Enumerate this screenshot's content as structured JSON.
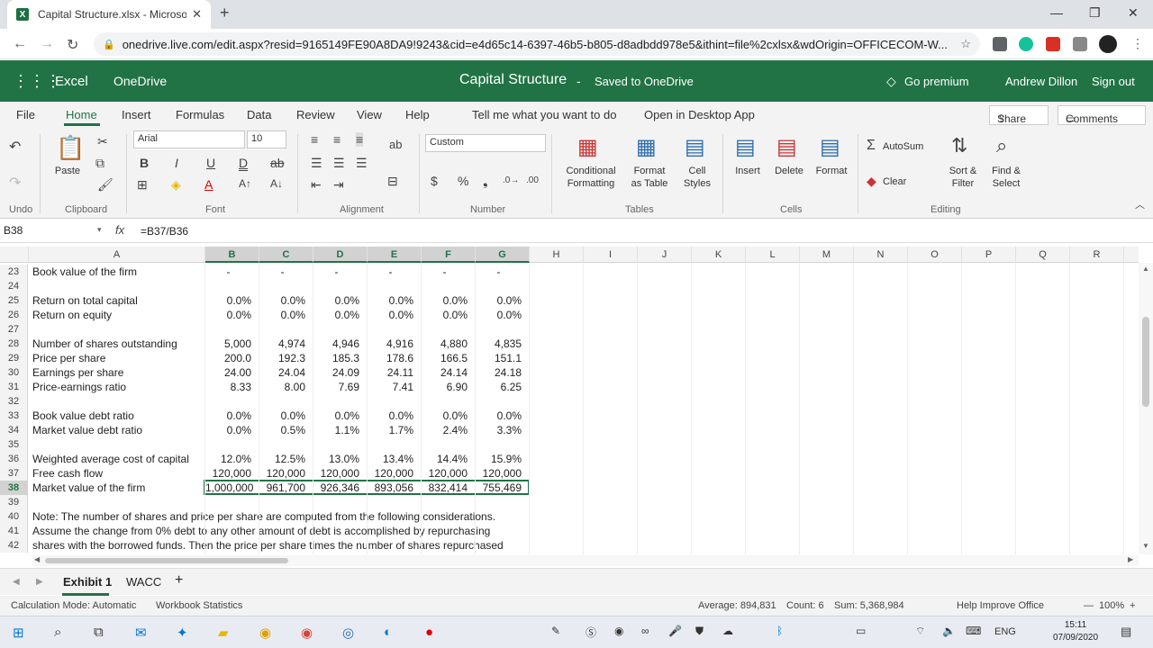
{
  "browser": {
    "tab_title": "Capital Structure.xlsx - Microsoft",
    "url": "onedrive.live.com/edit.aspx?resid=9165149FE90A8DA9!9243&cid=e4d65c14-6397-46b5-b805-d8adbdd978e5&ithint=file%2cxlsx&wdOrigin=OFFICECOM-W..."
  },
  "app": {
    "name": "Excel",
    "service": "OneDrive",
    "doc_title": "Capital Structure",
    "separator": "-",
    "save_status": "Saved to OneDrive",
    "premium": "Go premium",
    "user": "Andrew Dillon",
    "signout": "Sign out"
  },
  "ribbon_tabs": [
    "File",
    "Home",
    "Insert",
    "Formulas",
    "Data",
    "Review",
    "View",
    "Help",
    "Tell me what you want to do",
    "Open in Desktop App"
  ],
  "share_label": "Share",
  "comments_label": "Comments",
  "ribbon": {
    "undo": "Undo",
    "paste": "Paste",
    "clipboard": "Clipboard",
    "font_name": "Arial",
    "font_size": "10",
    "font": "Font",
    "alignment": "Alignment",
    "number_format": "Custom",
    "number": "Number",
    "cond_fmt_1": "Conditional",
    "cond_fmt_2": "Formatting",
    "fmt_table_1": "Format",
    "fmt_table_2": "as Table",
    "cell_styles_1": "Cell",
    "cell_styles_2": "Styles",
    "tables": "Tables",
    "insert": "Insert",
    "delete": "Delete",
    "format": "Format",
    "cells": "Cells",
    "autosum": "AutoSum",
    "clear": "Clear",
    "sort_1": "Sort &",
    "sort_2": "Filter",
    "find_1": "Find &",
    "find_2": "Select",
    "editing": "Editing"
  },
  "formula_bar": {
    "name_box": "B38",
    "fx": "fx",
    "formula": "=B37/B36"
  },
  "columns": [
    "A",
    "B",
    "C",
    "D",
    "E",
    "F",
    "G",
    "H",
    "I",
    "J",
    "K",
    "L",
    "M",
    "N",
    "O",
    "P",
    "Q",
    "R"
  ],
  "rows": [
    {
      "n": "23",
      "label": "Book value of the firm",
      "vals": [
        "-",
        "-",
        "-",
        "-",
        "-",
        "-"
      ]
    },
    {
      "n": "24",
      "label": "",
      "vals": []
    },
    {
      "n": "25",
      "label": "Return on total capital",
      "vals": [
        "0.0%",
        "0.0%",
        "0.0%",
        "0.0%",
        "0.0%",
        "0.0%"
      ]
    },
    {
      "n": "26",
      "label": "Return on equity",
      "vals": [
        "0.0%",
        "0.0%",
        "0.0%",
        "0.0%",
        "0.0%",
        "0.0%"
      ]
    },
    {
      "n": "27",
      "label": "",
      "vals": []
    },
    {
      "n": "28",
      "label": "Number of shares outstanding",
      "vals": [
        "5,000",
        "4,974",
        "4,946",
        "4,916",
        "4,880",
        "4,835"
      ]
    },
    {
      "n": "29",
      "label": "Price per share",
      "vals": [
        "200.0",
        "192.3",
        "185.3",
        "178.6",
        "166.5",
        "151.1"
      ]
    },
    {
      "n": "30",
      "label": "Earnings per share",
      "vals": [
        "24.00",
        "24.04",
        "24.09",
        "24.11",
        "24.14",
        "24.18"
      ]
    },
    {
      "n": "31",
      "label": "Price-earnings ratio",
      "vals": [
        "8.33",
        "8.00",
        "7.69",
        "7.41",
        "6.90",
        "6.25"
      ]
    },
    {
      "n": "32",
      "label": "",
      "vals": []
    },
    {
      "n": "33",
      "label": "Book value debt ratio",
      "vals": [
        "0.0%",
        "0.0%",
        "0.0%",
        "0.0%",
        "0.0%",
        "0.0%"
      ]
    },
    {
      "n": "34",
      "label": "Market value debt ratio",
      "vals": [
        "0.0%",
        "0.5%",
        "1.1%",
        "1.7%",
        "2.4%",
        "3.3%"
      ]
    },
    {
      "n": "35",
      "label": "",
      "vals": []
    },
    {
      "n": "36",
      "label": "Weighted average cost of capital",
      "vals": [
        "12.0%",
        "12.5%",
        "13.0%",
        "13.4%",
        "14.4%",
        "15.9%"
      ]
    },
    {
      "n": "37",
      "label": "Free cash flow",
      "vals": [
        "120,000",
        "120,000",
        "120,000",
        "120,000",
        "120,000",
        "120,000"
      ]
    },
    {
      "n": "38",
      "label": "Market value of the firm",
      "vals": [
        "1,000,000",
        "961,700",
        "926,346",
        "893,056",
        "832,414",
        "755,469"
      ]
    },
    {
      "n": "39",
      "label": "",
      "vals": []
    },
    {
      "n": "40",
      "label": "Note:  The number of shares and price per share are computed from the following considerations.",
      "vals": []
    },
    {
      "n": "41",
      "label": "Assume the change from 0% debt to any other amount of debt is accomplished by repurchasing",
      "vals": []
    },
    {
      "n": "42",
      "label": "shares with the borrowed funds.  Then the price per share times the number of shares repurchased",
      "vals": []
    }
  ],
  "sheets": [
    "Exhibit 1",
    "WACC"
  ],
  "add_sheet": "+",
  "status": {
    "calc_mode": "Calculation Mode: Automatic",
    "workbook_stats": "Workbook Statistics",
    "average": "Average: 894,831",
    "count": "Count: 6",
    "sum": "Sum: 5,368,984",
    "help": "Help Improve Office",
    "zoom": "100%"
  },
  "taskbar": {
    "time": "15:11",
    "date": "07/09/2020",
    "lang": "ENG"
  }
}
